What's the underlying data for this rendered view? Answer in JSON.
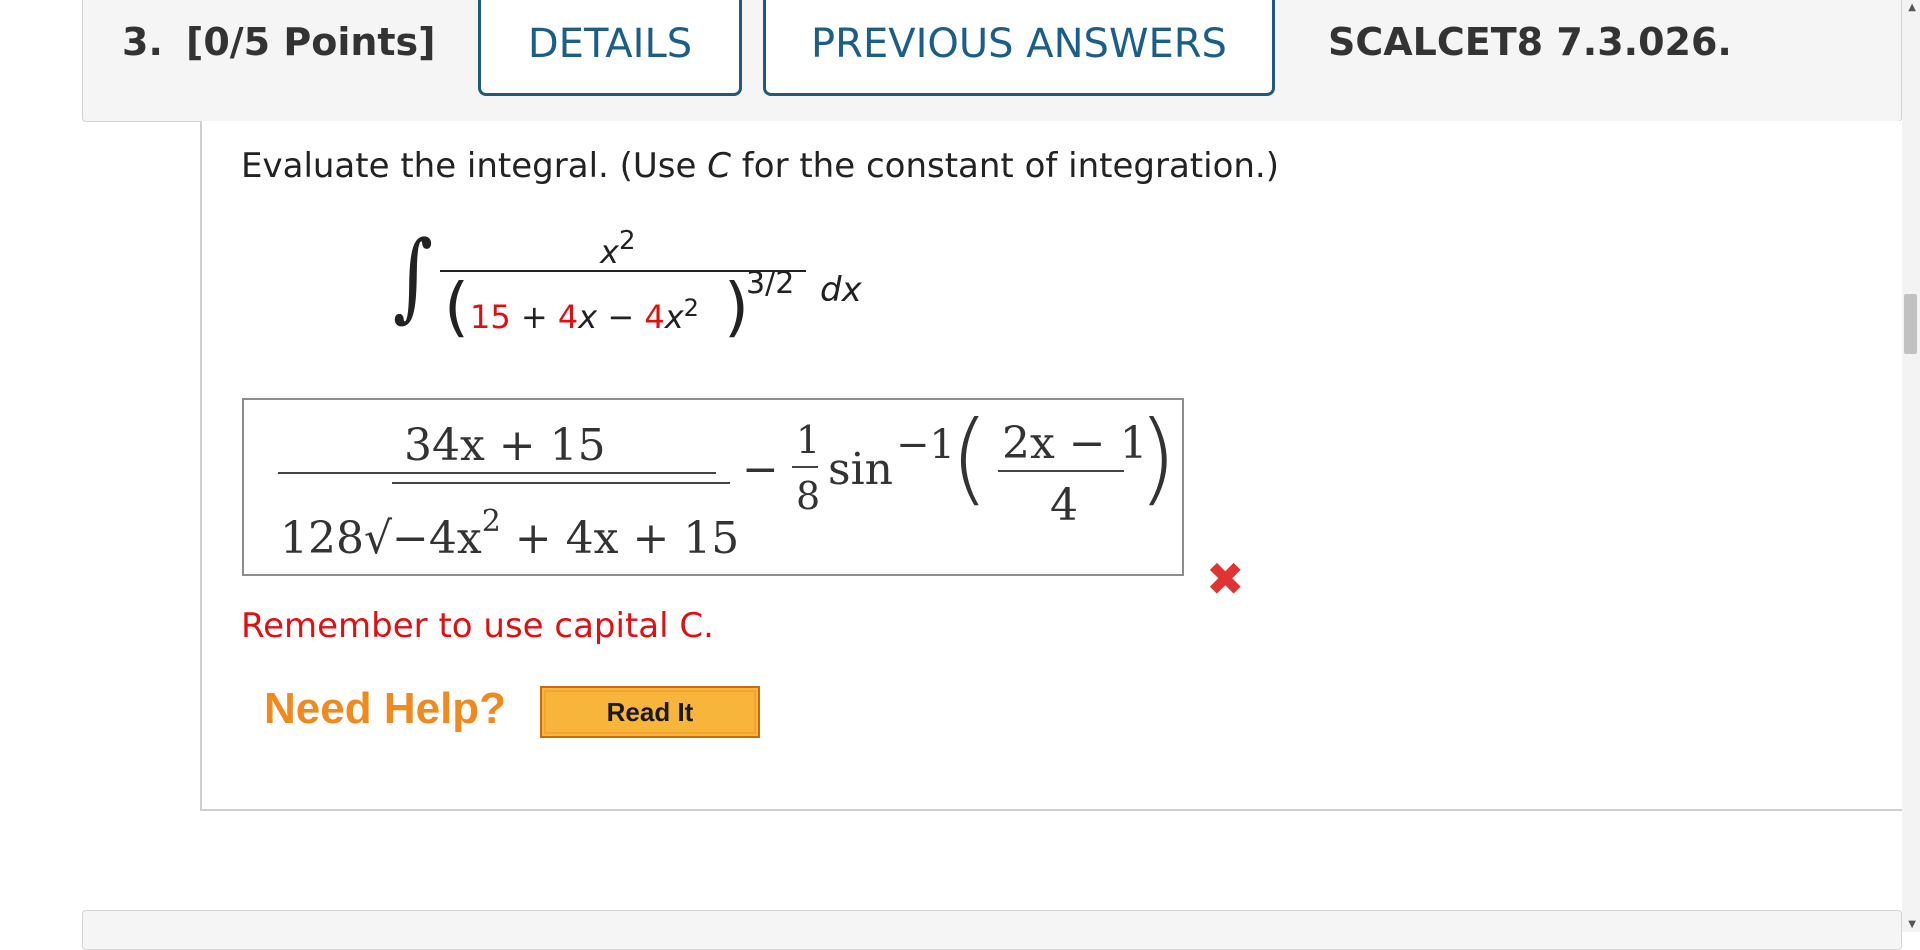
{
  "question": {
    "number": "3.",
    "points": "[0/5 Points]",
    "details_label": "DETAILS",
    "previous_answers_label": "PREVIOUS ANSWERS",
    "code": "SCALCET8 7.3.026."
  },
  "problem": {
    "instruction_pre": "Evaluate the integral. (Use ",
    "instruction_var": "C",
    "instruction_post": " for the constant of integration.)",
    "integrand_numerator": "x",
    "integrand_numerator_exp": "2",
    "den_a": "15",
    "den_plus": " + ",
    "den_b": "4",
    "den_x": "x",
    "den_minus": " − ",
    "den_c": "4",
    "den_x2": "x",
    "den_x2_exp": "2",
    "outer_exponent": "3/2",
    "differential": "dx"
  },
  "answer": {
    "numerator": "34x + 15",
    "denominator_coef": "128",
    "denominator_radical": "−4x",
    "denominator_radical_exp": "2",
    "denominator_radical_rest": " + 4x + 15",
    "minus": "−",
    "coef_num": "1",
    "coef_den": "8",
    "func": "sin",
    "func_exp": "−1",
    "arg_num": "2x − 1",
    "arg_den": "4"
  },
  "feedback": {
    "message": "Remember to use capital C.",
    "status_icon": "x-mark-icon"
  },
  "help": {
    "need_help_label": "Need Help?",
    "read_it_label": "Read It"
  },
  "colors": {
    "accent": "#1b5e8a",
    "error": "#e01010",
    "help_orange": "#f08a1e",
    "button_yellow": "#f7b53c"
  }
}
